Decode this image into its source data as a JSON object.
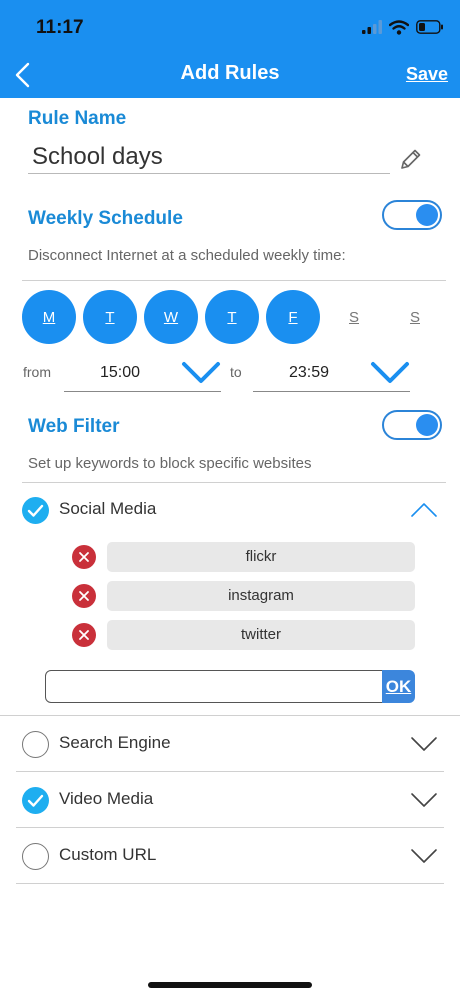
{
  "status_bar": {
    "time": "11:17",
    "icons": [
      "signal-icon",
      "wifi-icon",
      "battery-icon"
    ]
  },
  "nav": {
    "title": "Add Rules",
    "save_label": "Save",
    "back_icon": "chevron-left-icon"
  },
  "rule_name": {
    "label": "Rule Name",
    "value": "School days",
    "edit_icon": "pencil-icon"
  },
  "weekly_schedule": {
    "label": "Weekly Schedule",
    "enabled": true,
    "description": "Disconnect Internet at a scheduled weekly time:",
    "days": [
      {
        "label": "M",
        "selected": true
      },
      {
        "label": "T",
        "selected": true
      },
      {
        "label": "W",
        "selected": true
      },
      {
        "label": "T",
        "selected": true
      },
      {
        "label": "F",
        "selected": true
      },
      {
        "label": "S",
        "selected": false
      },
      {
        "label": "S",
        "selected": false
      }
    ],
    "from_label": "from",
    "from_value": "15:00",
    "to_label": "to",
    "to_value": "23:59"
  },
  "web_filter": {
    "label": "Web Filter",
    "enabled": true,
    "description": "Set up keywords to block specific websites",
    "categories": [
      {
        "label": "Social Media",
        "checked": true,
        "expanded": true
      },
      {
        "label": "Search Engine",
        "checked": false,
        "expanded": false
      },
      {
        "label": "Video Media",
        "checked": true,
        "expanded": false
      },
      {
        "label": "Custom URL",
        "checked": false,
        "expanded": false
      }
    ],
    "keywords": [
      "flickr",
      "instagram",
      "twitter"
    ],
    "keyword_input_value": "",
    "ok_label": "OK"
  },
  "colors": {
    "accent": "#1a8ff0",
    "section_title": "#1a8ad6",
    "remove": "#c9303a",
    "check": "#1eaef0"
  }
}
